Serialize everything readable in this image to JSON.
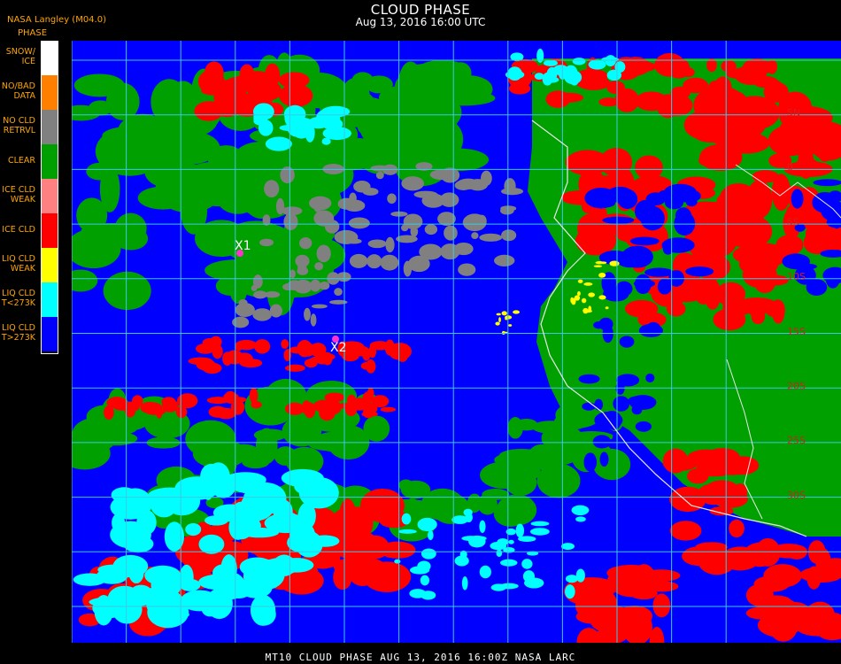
{
  "header": {
    "title": "CLOUD PHASE",
    "subtitle": "Aug 13, 2016 16:00 UTC",
    "source": "NASA Langley (M04.0)"
  },
  "legend": {
    "title": "PHASE",
    "items": [
      {
        "label": "SNOW/\nICE",
        "color": "#ffffff"
      },
      {
        "label": "NO/BAD\nDATA",
        "color": "#ff7f00"
      },
      {
        "label": "NO CLD\nRETRVL",
        "color": "#808080"
      },
      {
        "label": "CLEAR",
        "color": "#00a000"
      },
      {
        "label": "ICE CLD\nWEAK",
        "color": "#ff8080"
      },
      {
        "label": "ICE CLD",
        "color": "#ff0000"
      },
      {
        "label": "LIQ CLD\nWEAK",
        "color": "#ffff00"
      },
      {
        "label": "LIQ CLD\nT<273K",
        "color": "#00ffff"
      },
      {
        "label": "LIQ CLD\nT>273K",
        "color": "#0000ff"
      }
    ]
  },
  "map": {
    "markers": [
      {
        "label": "X1",
        "color": "#ff33cc"
      },
      {
        "label": "X2",
        "color": "#ff33cc"
      }
    ],
    "lat_labels": [
      "5N",
      "0",
      "5S",
      "10S",
      "15S",
      "20S",
      "25S",
      "30S"
    ],
    "grid_color": "#3cc8e6",
    "coast_color": "#e8e8e8"
  },
  "footer": {
    "text": "MT10  CLOUD PHASE   AUG 13, 2016 16:00Z  NASA LARC"
  }
}
